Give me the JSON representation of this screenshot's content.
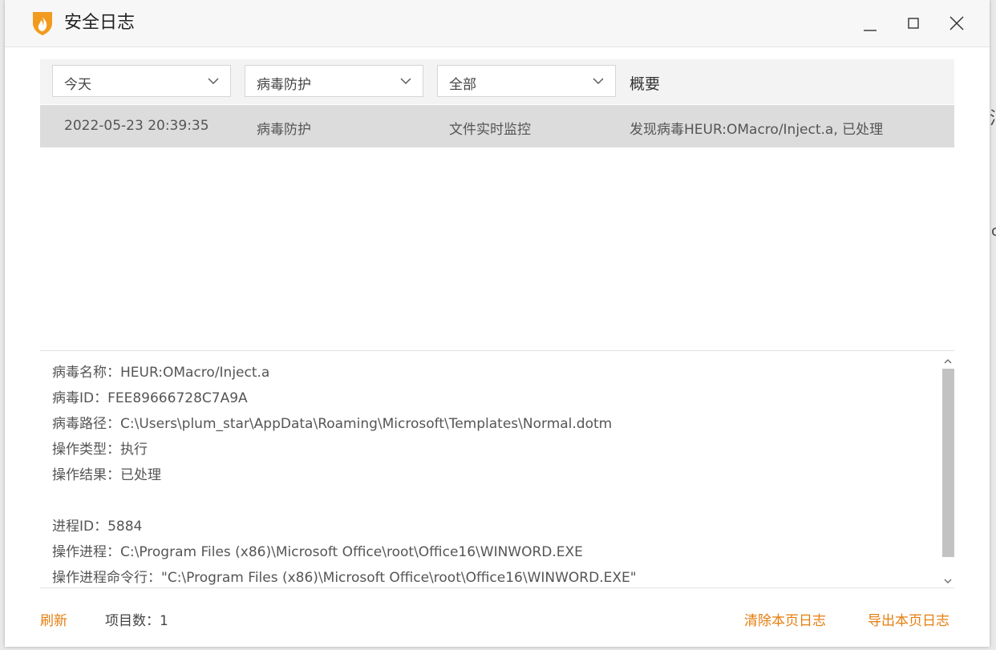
{
  "window": {
    "title": "安全日志"
  },
  "window_controls": {
    "minimize": "minimize-icon",
    "maximize": "maximize-icon",
    "close": "close-icon"
  },
  "filters": {
    "date": "今天",
    "category": "病毒防护",
    "scope": "全部",
    "summary_header": "概要"
  },
  "log_rows": [
    {
      "time": "2022-05-23 20:39:35",
      "type": "病毒防护",
      "source": "文件实时监控",
      "summary": "发现病毒HEUR:OMacro/Inject.a, 已处理"
    }
  ],
  "details": {
    "virus_name": "病毒名称：HEUR:OMacro/Inject.a",
    "virus_id": "病毒ID：FEE89666728C7A9A",
    "virus_path": "病毒路径：C:\\Users\\plum_star\\AppData\\Roaming\\Microsoft\\Templates\\Normal.dotm",
    "op_type": "操作类型：执行",
    "op_result": "操作结果：已处理",
    "pid": "进程ID：5884",
    "process": "操作进程：C:\\Program Files (x86)\\Microsoft Office\\root\\Office16\\WINWORD.EXE",
    "cmdline": "操作进程命令行：\"C:\\Program Files (x86)\\Microsoft Office\\root\\Office16\\WINWORD.EXE\""
  },
  "footer": {
    "refresh": "刷新",
    "item_count": "项目数：1",
    "clear": "清除本页日志",
    "export": "导出本页日志"
  },
  "colors": {
    "accent": "#e57e10",
    "selected_row": "#dcdcdc",
    "filter_bar": "#f3f3f3"
  }
}
